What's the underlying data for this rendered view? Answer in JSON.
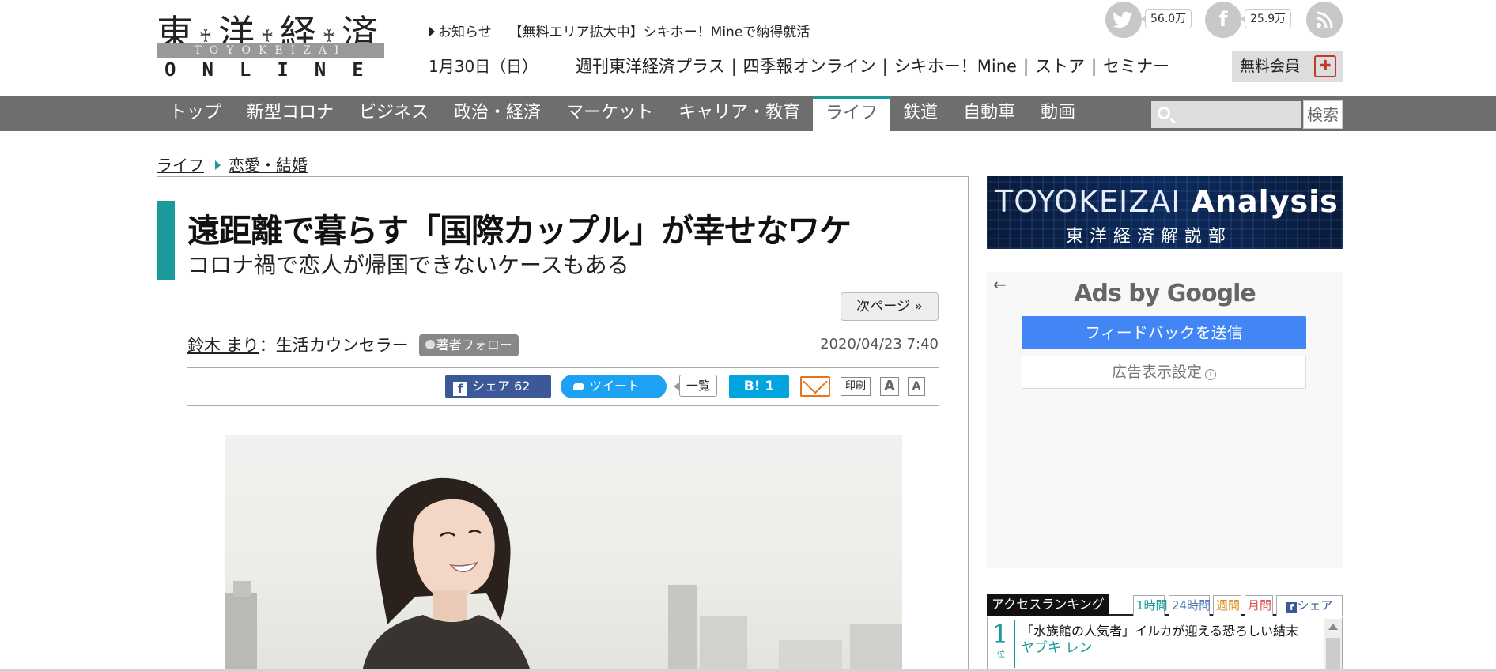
{
  "header": {
    "logo": {
      "kanji": [
        "東",
        "洋",
        "経",
        "済"
      ],
      "romaji": "TOYOKEIZAI",
      "online": "ONLINE"
    },
    "news": {
      "label": "お知らせ",
      "text": "【無料エリア拡大中】シキホー！Mineで納得就活"
    },
    "date": "1月30日（日）",
    "top_links": [
      "週刊東洋経済プラス",
      "四季報オンライン",
      "シキホー！Mine",
      "ストア",
      "セミナー"
    ],
    "social": {
      "twitter": {
        "icon": "twitter-icon",
        "count": "56.0万"
      },
      "facebook": {
        "icon": "facebook-icon",
        "count": "25.9万"
      },
      "rss": {
        "icon": "rss-icon"
      }
    },
    "member_button": "無料会員"
  },
  "nav": {
    "items": [
      "トップ",
      "新型コロナ",
      "ビジネス",
      "政治・経済",
      "マーケット",
      "キャリア・教育",
      "ライフ",
      "鉄道",
      "自動車",
      "動画"
    ],
    "active": "ライフ",
    "search_button": "検索",
    "search_value": ""
  },
  "breadcrumb": [
    "ライフ",
    "恋愛・結婚"
  ],
  "article": {
    "title": "遠距離で暮らす「国際カップル」が幸せなワケ",
    "subtitle": "コロナ禍で恋人が帰国できないケースもある",
    "next_page": "次ページ »",
    "author": "鈴木 まり",
    "author_role": "：生活カウンセラー",
    "follow_label": "著者フォロー",
    "date": "2020/04/23 7:40",
    "share": {
      "facebook": "シェア 62",
      "twitter": "ツイート",
      "list": "一覧",
      "hatena": "B! 1",
      "print": "印刷",
      "font_large": "A",
      "font_small": "A"
    }
  },
  "sidebar": {
    "banner": {
      "line1_a": "TOYOKEIZAI",
      "line1_b": "Analysis",
      "line2": "東洋経済解説部"
    },
    "ads": {
      "back": "←",
      "title_a": "Ads by ",
      "title_b": "Google",
      "feedback": "フィードバックを送信",
      "settings": "広告表示設定"
    },
    "ranking": {
      "title": "アクセスランキング",
      "tabs": [
        "1時間",
        "24時間",
        "週間",
        "月間",
        "シェア"
      ],
      "tab_colors": [
        "#1a9a9a",
        "#4a7ab8",
        "#e08a1e",
        "#d9534f",
        "#3b5998"
      ],
      "items": [
        {
          "rank": "1",
          "rank_unit": "位",
          "title": "「水族館の人気者」イルカが迎える恐ろしい結末",
          "author": "ヤブキ レン"
        }
      ]
    }
  }
}
